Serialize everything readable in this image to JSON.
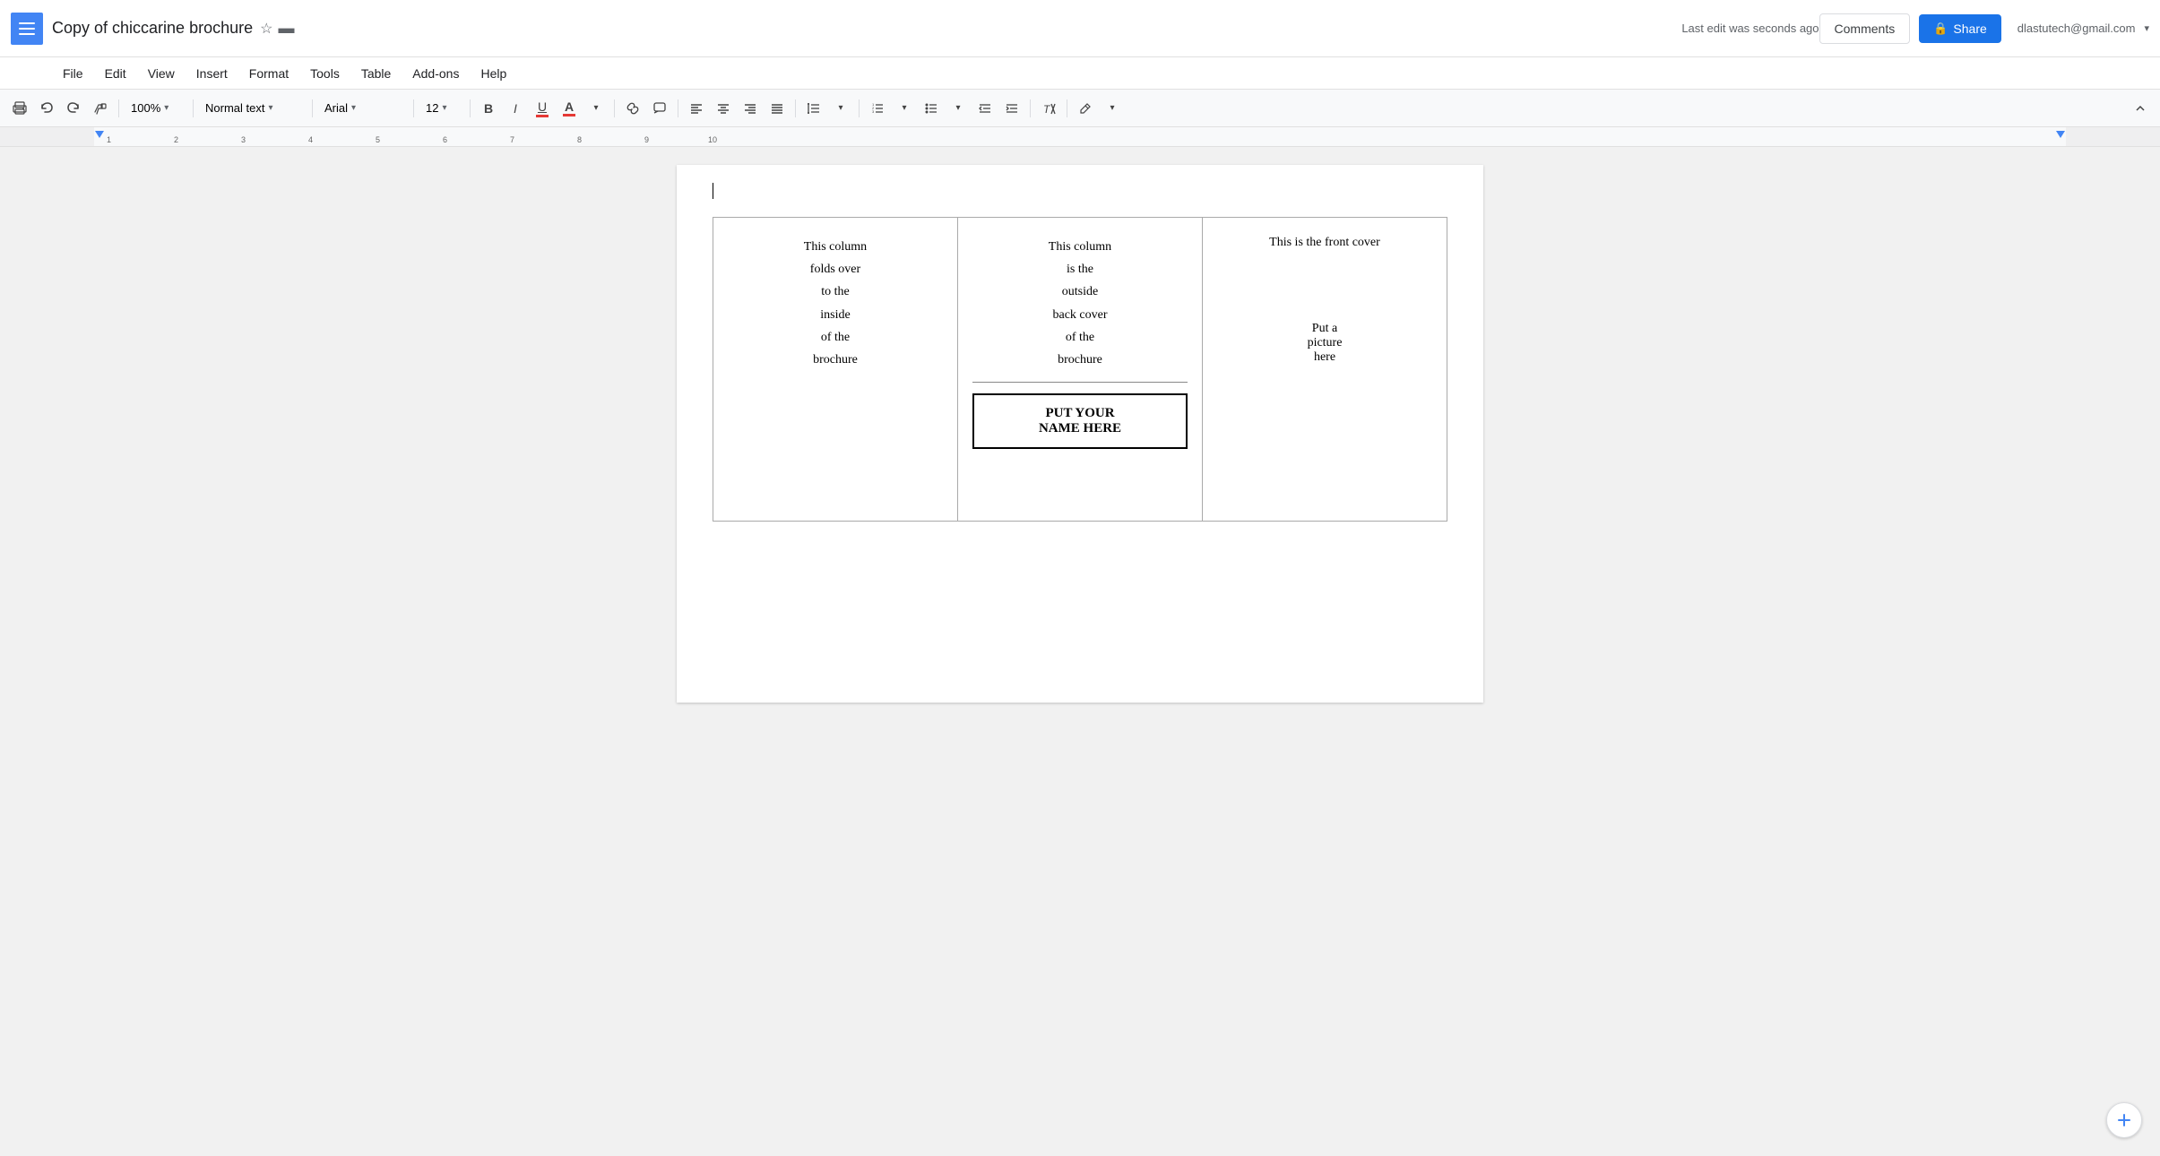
{
  "app": {
    "menu_icon": "☰",
    "title": "Copy of chiccarine brochure",
    "star_icon": "☆",
    "folder_icon": "▬"
  },
  "header": {
    "user_email": "dlastutech@gmail.com",
    "dropdown_arrow": "▾",
    "comments_label": "Comments",
    "share_label": "Share",
    "last_edit": "Last edit was seconds ago"
  },
  "menubar": {
    "items": [
      "File",
      "Edit",
      "View",
      "Insert",
      "Format",
      "Tools",
      "Table",
      "Add-ons",
      "Help"
    ]
  },
  "toolbar": {
    "zoom": "100%",
    "style": "Normal text",
    "font": "Arial",
    "size": "12",
    "bold": "B",
    "italic": "I",
    "underline": "U"
  },
  "document": {
    "col1": "This column\nfolds over\nto the\ninside\nof the\nbrochure",
    "col2_top": "This column\nis the\noutside\nback cover\nof the\nbrochure",
    "col2_name": "PUT YOUR\nNAME HERE",
    "col3_top": "This is the front cover",
    "col3_bottom": "Put a\npicture\nhere"
  }
}
